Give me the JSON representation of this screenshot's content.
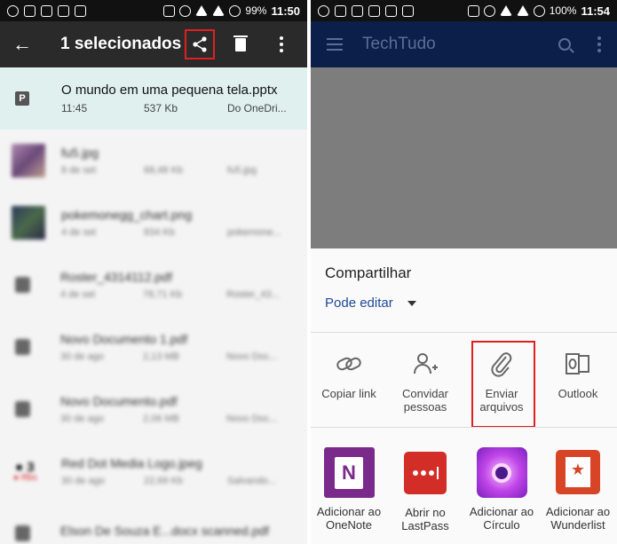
{
  "left": {
    "status": {
      "battery": "99%",
      "time": "11:50"
    },
    "toolbar": {
      "back_icon": "arrow-back-icon",
      "title": "1 selecionados",
      "share_icon": "share-icon",
      "delete_icon": "trash-icon",
      "more_icon": "more-vert-icon"
    },
    "selected_file": {
      "type_letter": "P",
      "name": "O mundo em uma pequena tela.pptx",
      "time": "11:45",
      "size": "537 Kb",
      "source": "Do OneDri..."
    },
    "files": [
      {
        "name": "fu5.jpg",
        "date": "8 de set",
        "size": "68,48 Kb",
        "source": "fu5.jpg",
        "thumb": "#8a6a8a"
      },
      {
        "name": "pokemonegg_chart.png",
        "date": "4 de set",
        "size": "834 Kb",
        "source": "pokemone...",
        "thumb": "#3a4a5a"
      },
      {
        "name": "Roster_4314112.pdf",
        "date": "4 de set",
        "size": "78,71 Kb",
        "source": "Roster_43...",
        "thumb": ""
      },
      {
        "name": "Novo Documento 1.pdf",
        "date": "30 de ago",
        "size": "2,13 MB",
        "source": "Novo Doc...",
        "thumb": ""
      },
      {
        "name": "Novo Documento.pdf",
        "date": "30 de ago",
        "size": "2,06 MB",
        "source": "Novo Doc...",
        "thumb": ""
      },
      {
        "name": "Red Dot Media Logo.jpeg",
        "date": "30 de ago",
        "size": "22,69 Kb",
        "source": "Salvando...",
        "thumb": "logo"
      },
      {
        "name": "Elson De Souza E...docx scanned.pdf",
        "date": "",
        "size": "",
        "source": "",
        "thumb": ""
      }
    ]
  },
  "right": {
    "status": {
      "battery": "100%",
      "time": "11:54"
    },
    "toolbar": {
      "menu_icon": "hamburger-icon",
      "title": "TechTudo",
      "search_icon": "search-icon",
      "more_icon": "more-vert-icon"
    },
    "sheet": {
      "title": "Compartilhar",
      "permission": "Pode editar",
      "options": [
        {
          "label": "Copiar link",
          "icon": "link-icon"
        },
        {
          "label": "Convidar\npessoas",
          "icon": "add-person-icon"
        },
        {
          "label": "Enviar\narquivos",
          "icon": "paperclip-icon"
        },
        {
          "label": "Outlook",
          "icon": "outlook-icon"
        }
      ],
      "apps": [
        {
          "label": "Adicionar ao\nOneNote",
          "icon": "onenote-icon"
        },
        {
          "label": "Abrir no\nLastPass",
          "icon": "lastpass-icon"
        },
        {
          "label": "Adicionar ao\nCírculo",
          "icon": "circulo-icon"
        },
        {
          "label": "Adicionar ao\nWunderlist",
          "icon": "wunderlist-icon"
        }
      ]
    }
  },
  "colors": {
    "highlight": "#e02020",
    "selected_row": "#dff0ef",
    "right_toolbar": "#0b1f4a",
    "link_blue": "#1e4a96"
  }
}
